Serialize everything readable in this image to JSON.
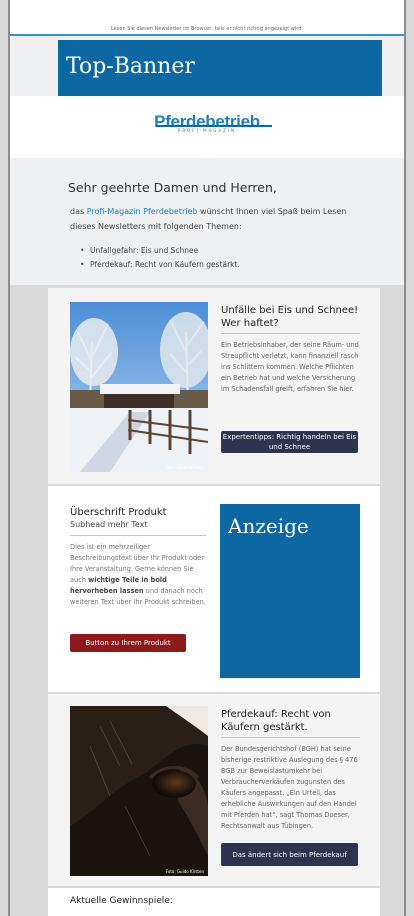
{
  "preheader": "Lesen Sie diesen Newsletter im Browser, falls er nicht richtig angezeigt wird.",
  "banner": {
    "title": "Top-Banner"
  },
  "logo": {
    "name": "Pferdebetrieb",
    "subtitle": "PROFI-MAGAZIN"
  },
  "intro": {
    "greeting": "Sehr geehrte Damen und Herren,",
    "text_prefix": "das ",
    "magazine": "Profi-Magazin Pferdebetrieb",
    "text_suffix": " wünscht Ihnen viel Spaß beim Lesen dieses Newsletters mit folgenden Themen:",
    "topics": [
      "Unfallgefahr: Eis und Schnee",
      "Pferdekauf: Recht von Käufern gestärkt."
    ]
  },
  "article1": {
    "title": "Unfälle bei Eis und Schnee! Wer haftet?",
    "text": "Ein Betriebsinhaber, der seine Räum- und Streupflicht verletzt, kann finanziell rasch ins Schlittern kommen. Welche Pflichten ein Betrieb hat und welche Versicherung im Schadensfall greift, erfahren Sie hier.",
    "button": "Expertentipps: Richtig handeln bei Eis und Schnee",
    "credit": "Foto: Guido Kirsten"
  },
  "product": {
    "title": "Überschrift Produkt",
    "subhead": "Subhead mehr Text",
    "text_a": "Dies ist ein mehrzeiliger Beschreibungstext über Ihr Produkt oder Ihre Veranstaltung. Gerne können Sie auch ",
    "text_bold": "wichtige Teile in bold hervorheben lassen",
    "text_b": " und danach noch weiteren Text über Ihr Produkt schreiben.",
    "button": "Button zu Ihrem Produkt"
  },
  "ad": {
    "label": "Anzeige"
  },
  "article2": {
    "title": "Pferdekauf: Recht von Käufern gestärkt.",
    "text": "Der Bundesgerichtshof (BGH) hat seine bisherige restriktive Auslegung des § 476 BGB zur Beweislastumkehr bei Verbraucherverkäufen zugunsten des Käufers angepasst. „Ein Urteil, das erhebliche Auswirkungen auf den Handel mit Pferden hat“, sagt Thomas Doeser, Rechtsanwalt aus Tübingen.",
    "button": "Das ändert sich beim Pferdekauf",
    "credit": "Foto: Guido Kirsten"
  },
  "footer_section": {
    "title": "Aktuelle Gewinnspiele:"
  },
  "colors": {
    "brand": "#0c67a3",
    "button_dark": "#2e3450",
    "button_red": "#8b1a1a",
    "link": "#1d7fbd"
  }
}
